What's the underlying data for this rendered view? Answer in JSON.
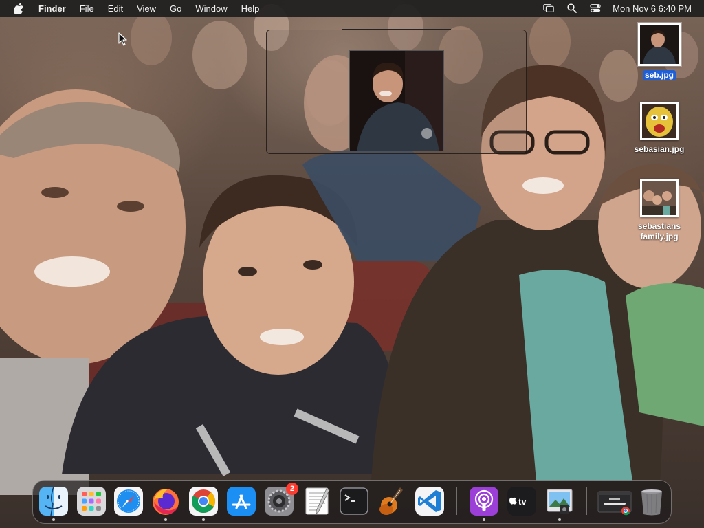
{
  "menubar": {
    "app_name": "Finder",
    "menus": [
      "File",
      "Edit",
      "View",
      "Go",
      "Window",
      "Help"
    ],
    "clock": "Mon Nov 6  6:40 PM",
    "status_icons": [
      "screen-mirroring-icon",
      "spotlight-search-icon",
      "control-center-icon"
    ]
  },
  "desktop": {
    "icons": [
      {
        "label": "seb.jpg",
        "selected": true
      },
      {
        "label": "sebasian.jpg",
        "selected": false
      },
      {
        "label": "sebastians family.jpg",
        "selected": false
      }
    ]
  },
  "dock": {
    "apps": [
      {
        "name": "Finder",
        "icon": "finder-icon",
        "running": true
      },
      {
        "name": "Launchpad",
        "icon": "launchpad-icon",
        "running": false
      },
      {
        "name": "Safari",
        "icon": "safari-icon",
        "running": false
      },
      {
        "name": "Firefox",
        "icon": "firefox-icon",
        "running": true
      },
      {
        "name": "Chrome",
        "icon": "chrome-icon",
        "running": true
      },
      {
        "name": "App Store",
        "icon": "app-store-icon",
        "running": false
      },
      {
        "name": "System Settings",
        "icon": "system-settings-icon",
        "running": false,
        "badge": "2"
      },
      {
        "name": "TextEdit",
        "icon": "textedit-icon",
        "running": false
      },
      {
        "name": "Terminal",
        "icon": "terminal-icon",
        "running": false
      },
      {
        "name": "GarageBand",
        "icon": "garageband-icon",
        "running": false
      },
      {
        "name": "Visual Studio Code",
        "icon": "vscode-icon",
        "running": false
      },
      {
        "name": "Podcasts",
        "icon": "podcasts-icon",
        "running": true
      },
      {
        "name": "Apple TV",
        "icon": "apple-tv-icon",
        "running": false
      },
      {
        "name": "Preview",
        "icon": "preview-icon",
        "running": true
      },
      {
        "name": "Chrome Window",
        "icon": "chrome-window-thumbnail-icon",
        "running": false
      },
      {
        "name": "Trash",
        "icon": "trash-icon",
        "running": false
      }
    ]
  },
  "colors": {
    "selection": "#1f5fd6",
    "badge": "#ff3b30",
    "menubar": "#1e1e1e"
  }
}
